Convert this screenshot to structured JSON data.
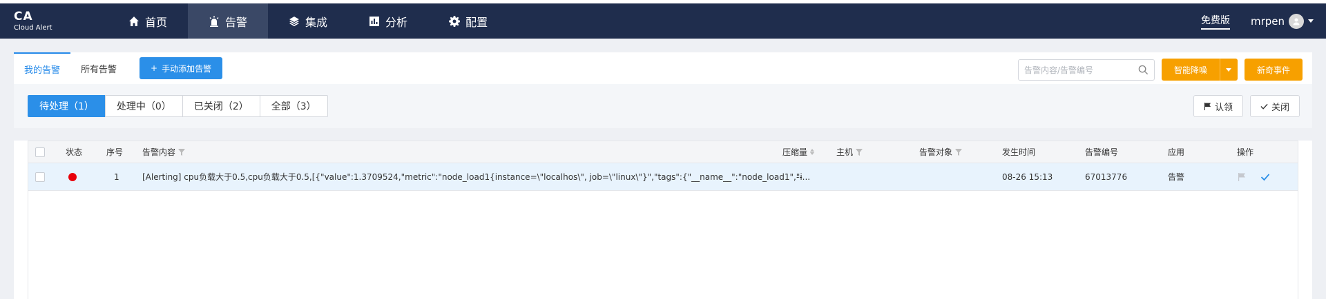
{
  "logo": {
    "title": "CA",
    "subtitle": "Cloud Alert"
  },
  "nav": [
    {
      "label": "首页",
      "icon": "home-icon"
    },
    {
      "label": "告警",
      "icon": "alarm-icon",
      "active": true
    },
    {
      "label": "集成",
      "icon": "layers-icon"
    },
    {
      "label": "分析",
      "icon": "chart-icon"
    },
    {
      "label": "配置",
      "icon": "gear-icon"
    }
  ],
  "header_right": {
    "plan": "免费版",
    "username": "mrpen"
  },
  "tabs": {
    "mine": "我的告警",
    "all": "所有告警"
  },
  "add_button": "手动添加告警",
  "search": {
    "placeholder": "告警内容/告警编号"
  },
  "smart_button": "智能降噪",
  "new_event_button": "新奇事件",
  "filters": [
    {
      "label": "待处理（1）",
      "active": true
    },
    {
      "label": "处理中（0）"
    },
    {
      "label": "已关闭（2）"
    },
    {
      "label": "全部（3）"
    }
  ],
  "actions": {
    "claim": "认领",
    "close": "关闭"
  },
  "table": {
    "columns": {
      "status": "状态",
      "index": "序号",
      "content": "告警内容",
      "compression": "压缩量",
      "host": "主机",
      "target": "告警对象",
      "time": "发生时间",
      "number": "告警编号",
      "app": "应用",
      "ops": "操作"
    },
    "rows": [
      {
        "index": "1",
        "content": "[Alerting] cpu负载大于0.5,cpu负载大于0.5,[{\"value\":1.3709524,\"metric\":\"node_load1{instance=\\\"localhos\\\", job=\\\"linux\\\"}\",\"tags\":{\"__name__\":\"node_load1\",\"i...",
        "compression": "--",
        "host": "",
        "target": "",
        "time": "08-26 15:13",
        "number": "67013776",
        "app": "告警"
      }
    ]
  },
  "colors": {
    "navbar": "#1f2d4d",
    "primary": "#2b8fe8",
    "orange": "#f7a000",
    "status_red": "#e8000b"
  }
}
